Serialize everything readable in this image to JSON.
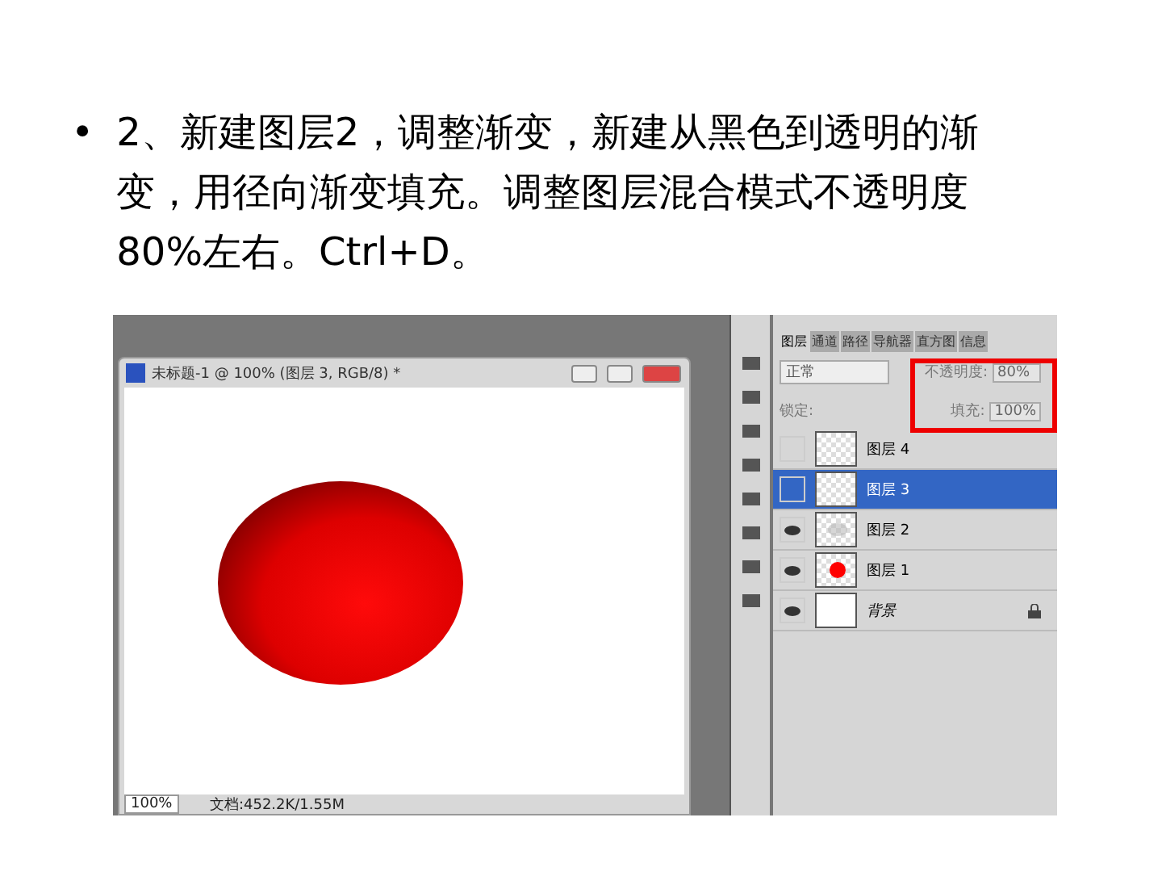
{
  "bullet": {
    "marker": "•",
    "text": "2、新建图层2，调整渐变，新建从黑色到透明的渐变，用径向渐变填充。调整图层混合模式不透明度80%左右。Ctrl+D。"
  },
  "document": {
    "title": "未标题-1 @ 100% (图层 3, RGB/8) *",
    "zoom": "100%",
    "status": "文档:452.2K/1.55M"
  },
  "panel": {
    "tabs": [
      {
        "label": "图层",
        "selected": true
      },
      {
        "label": "通道",
        "selected": false
      },
      {
        "label": "路径",
        "selected": false
      },
      {
        "label": "导航器",
        "selected": false
      },
      {
        "label": "直方图",
        "selected": false
      },
      {
        "label": "信息",
        "selected": false
      }
    ],
    "blend_mode": "正常",
    "opacity_label": "不透明度:",
    "opacity": "80%",
    "lock_label": "锁定:",
    "fill_label": "填充:",
    "fill": "100%",
    "highlighted": true,
    "layers": [
      {
        "name": "图层 4",
        "kind": "empty",
        "visible": false,
        "selected": false,
        "locked": false
      },
      {
        "name": "图层 3",
        "kind": "empty",
        "visible": false,
        "selected": true,
        "locked": false
      },
      {
        "name": "图层 2",
        "kind": "soft",
        "visible": true,
        "selected": false,
        "locked": false
      },
      {
        "name": "图层 1",
        "kind": "circle",
        "visible": true,
        "selected": false,
        "locked": false
      },
      {
        "name": "背景",
        "kind": "background",
        "visible": true,
        "selected": false,
        "locked": true
      }
    ]
  }
}
